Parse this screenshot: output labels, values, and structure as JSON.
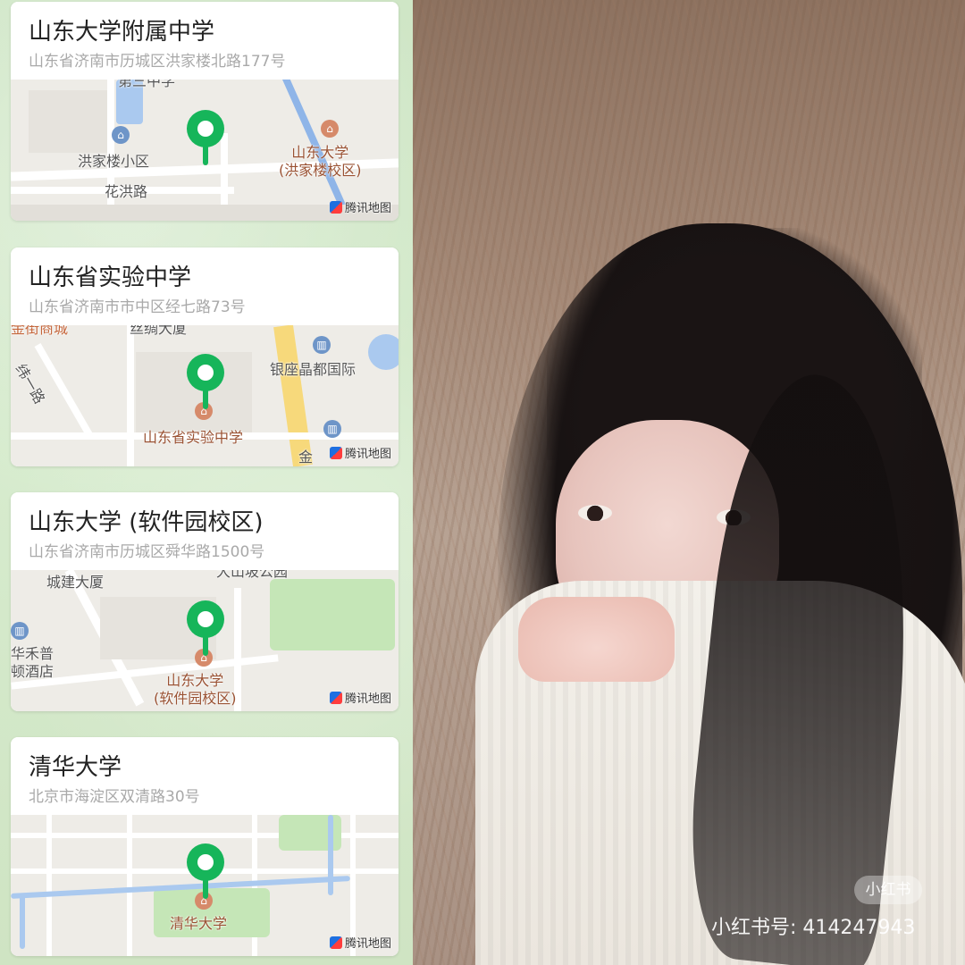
{
  "cards": [
    {
      "title": "山东大学附属中学",
      "address": "山东省济南市历城区洪家楼北路177号",
      "map_labels": {
        "top_cut": "第三中学",
        "residential": "洪家楼小区",
        "road": "花洪路",
        "poi": "山东大学\n(洪家楼校区)"
      },
      "brand": "腾讯地图"
    },
    {
      "title": "山东省实验中学",
      "address": "山东省济南市市中区经七路73号",
      "map_labels": {
        "top_cut_left": "金街商城",
        "top_cut_mid": "丝绸大厦",
        "building": "银座晶都国际",
        "road": "纬一路",
        "poi": "山东省实验中学",
        "bottom_cut": "金"
      },
      "brand": "腾讯地图"
    },
    {
      "title": "山东大学 (软件园校区)",
      "address": "山东省济南市历城区舜华路1500号",
      "map_labels": {
        "top_cut": "大山坡公园",
        "building": "城建大厦",
        "hotel": "华禾普\n顿酒店",
        "poi": "山东大学\n(软件园校区)"
      },
      "brand": "腾讯地图"
    },
    {
      "title": "清华大学",
      "address": "北京市海淀区双清路30号",
      "map_labels": {
        "poi": "清华大学"
      },
      "brand": "腾讯地图"
    }
  ],
  "watermark": {
    "badge": "小红书",
    "id_text": "小红书号: 414247943"
  },
  "colors": {
    "pin": "#16b55a",
    "poi_text": "#9a5233",
    "road_major": "#f7d97b",
    "water": "#aac9ef",
    "park": "#c5e6b7"
  },
  "icons": [
    "map-pin-icon",
    "tencent-map-logo-icon",
    "school-icon",
    "home-icon",
    "building-icon"
  ]
}
